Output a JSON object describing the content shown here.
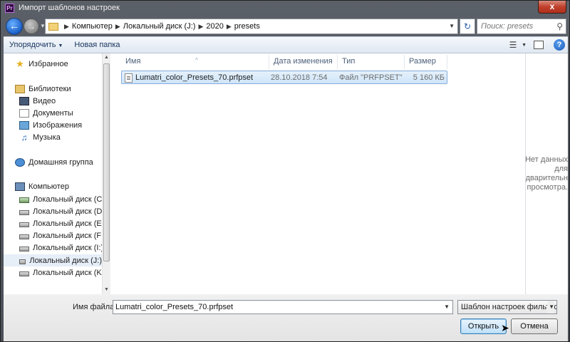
{
  "window": {
    "app_icon": "Pr",
    "title": "Импорт шаблонов настроек",
    "close_label": "x"
  },
  "address": {
    "back_icon": "back-arrow-icon",
    "forward_icon": "forward-arrow-icon",
    "path": [
      "Компьютер",
      "Локальный диск (J:)",
      "2020",
      "presets"
    ],
    "search_placeholder": "Поиск: presets"
  },
  "toolbar": {
    "organize_label": "Упорядочить",
    "new_folder_label": "Новая папка"
  },
  "sidebar": {
    "favorites": "Избранное",
    "libraries": "Библиотеки",
    "library_items": [
      "Видео",
      "Документы",
      "Изображения",
      "Музыка"
    ],
    "homegroup": "Домашняя группа",
    "computer": "Компьютер",
    "drives": [
      "Локальный диск (C:)",
      "Локальный диск (D:)",
      "Локальный диск (E:)",
      "Локальный диск (F:)",
      "Локальный диск (I:)",
      "Локальный диск (J:)",
      "Локальный диск (K:)"
    ],
    "selected_drive": "Локальный диск (J:)"
  },
  "file_list": {
    "columns": [
      "Имя",
      "Дата изменения",
      "Тип",
      "Размер"
    ],
    "rows": [
      {
        "name": "Lumatri_color_Presets_70.prfpset",
        "date": "28.10.2018 7:54",
        "type": "Файл \"PRFPSET\"",
        "size": "5 160 КБ"
      }
    ]
  },
  "preview": {
    "line1": "Нет данных",
    "line2": "для",
    "line3": "дварительн",
    "line4": "просмотра."
  },
  "bottom": {
    "filename_label": "Имя файла:",
    "filename_value": "Lumatri_color_Presets_70.prfpset",
    "filter_value": "Шаблон настроек фильтро",
    "open_label": "Открыть",
    "cancel_label": "Отмена"
  },
  "colors": {
    "title_bar": "#4a4f57",
    "selection": "#cfe5f9",
    "close_button": "#c0402c"
  }
}
